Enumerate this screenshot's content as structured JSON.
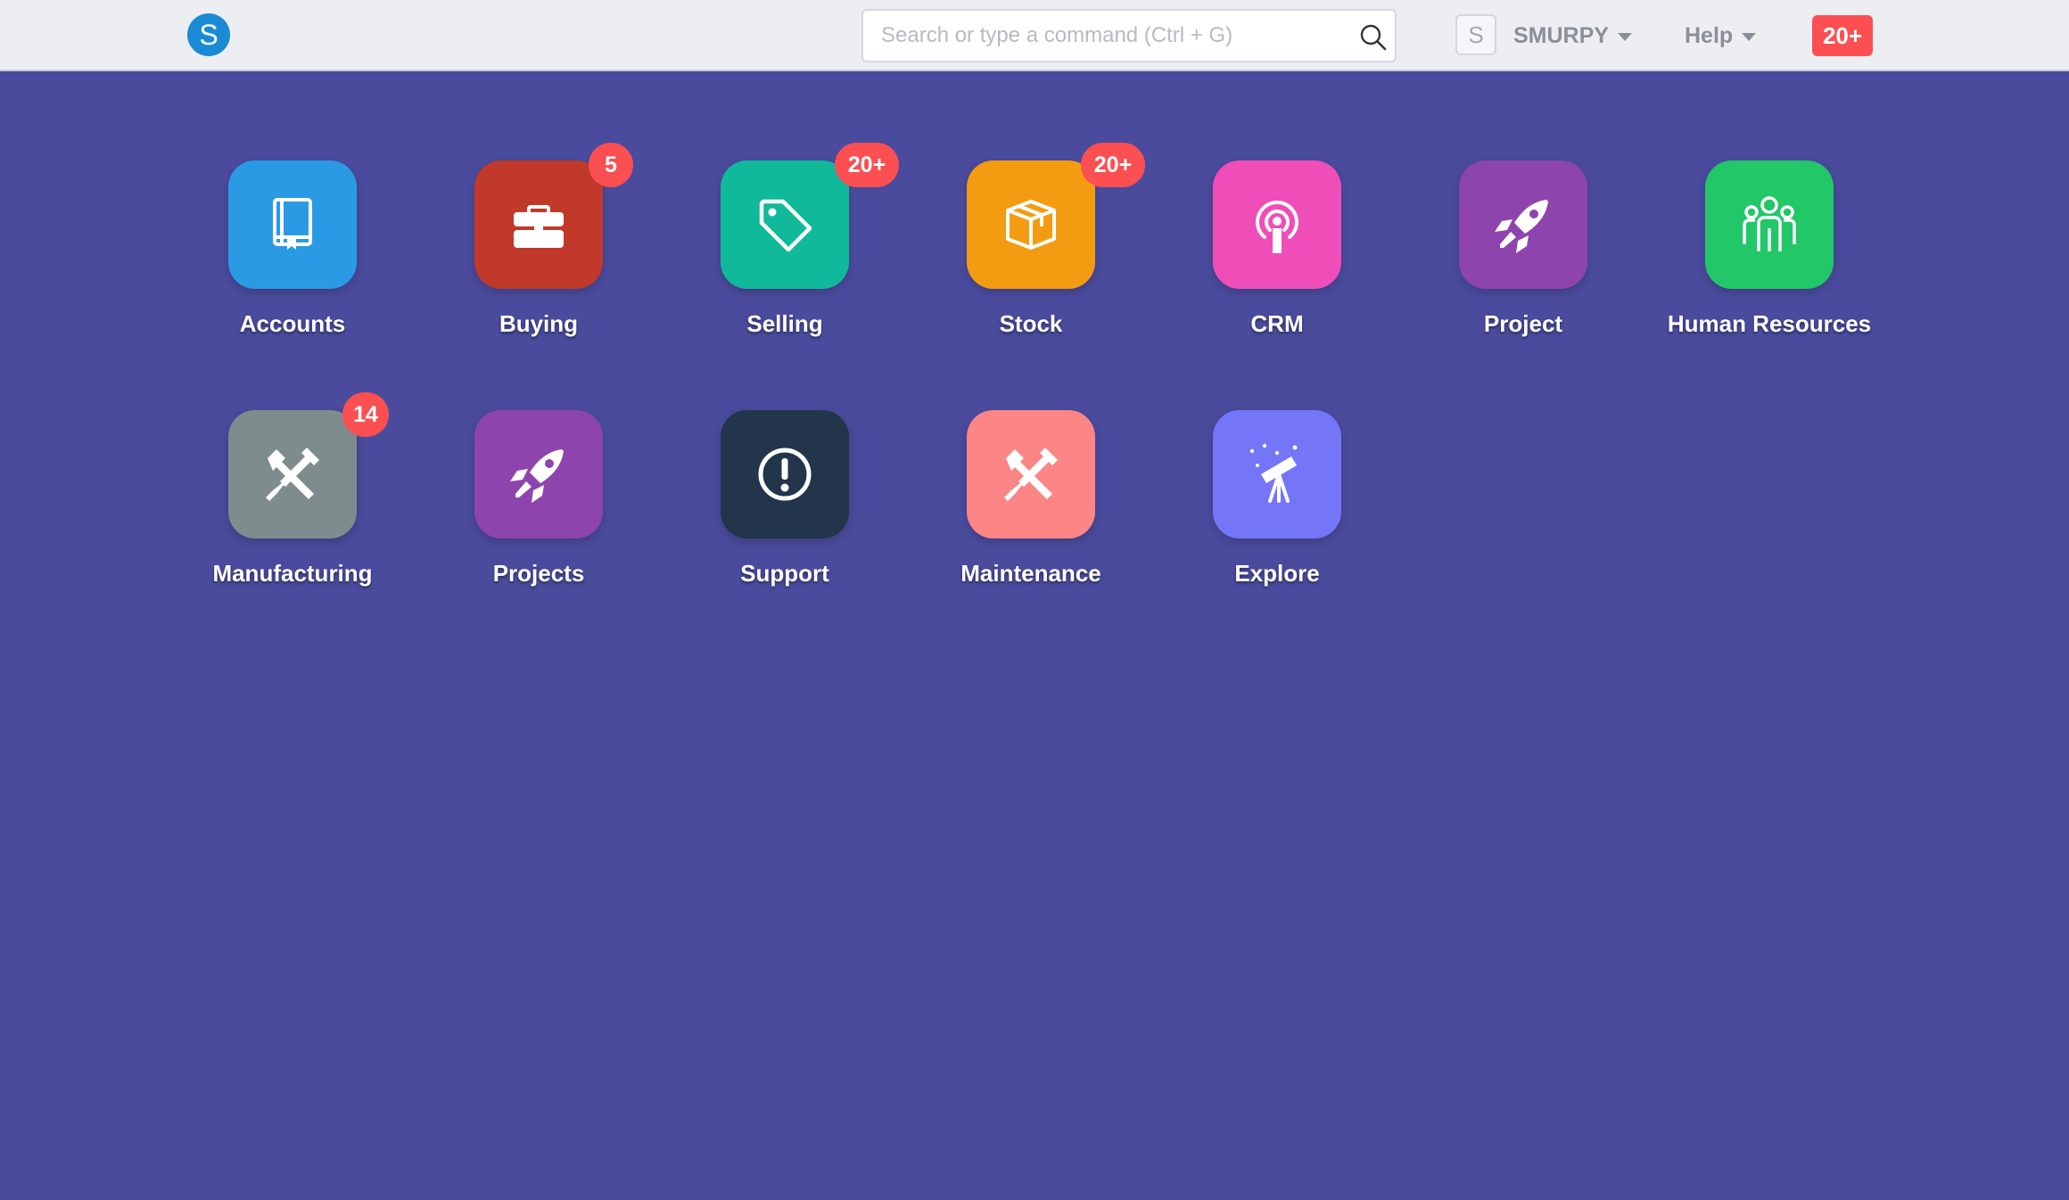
{
  "navbar": {
    "logo_letter": "S",
    "search_placeholder": "Search or type a command (Ctrl + G)",
    "avatar_letter": "S",
    "user_label": "SMURPY",
    "help_label": "Help",
    "notifications": "20+"
  },
  "modules": [
    {
      "label": "Accounts",
      "color": "#2b9ae4",
      "icon": "book-icon",
      "badge": ""
    },
    {
      "label": "Buying",
      "color": "#c0392b",
      "icon": "briefcase-icon",
      "badge": "5"
    },
    {
      "label": "Selling",
      "color": "#10b99a",
      "icon": "tag-icon",
      "badge": "20+"
    },
    {
      "label": "Stock",
      "color": "#f39c12",
      "icon": "box-icon",
      "badge": "20+"
    },
    {
      "label": "CRM",
      "color": "#ef4db7",
      "icon": "broadcast-icon",
      "badge": ""
    },
    {
      "label": "Project",
      "color": "#8e44ad",
      "icon": "rocket-icon",
      "badge": ""
    },
    {
      "label": "Human Resources",
      "color": "#22c768",
      "icon": "people-icon",
      "badge": ""
    },
    {
      "label": "Manufacturing",
      "color": "#7f8c8d",
      "icon": "tools-icon",
      "badge": "14"
    },
    {
      "label": "Projects",
      "color": "#8e44ad",
      "icon": "rocket-icon",
      "badge": ""
    },
    {
      "label": "Support",
      "color": "#22354b",
      "icon": "alert-icon",
      "badge": ""
    },
    {
      "label": "Maintenance",
      "color": "#fc8585",
      "icon": "tools-icon",
      "badge": ""
    },
    {
      "label": "Explore",
      "color": "#7575f8",
      "icon": "telescope-icon",
      "badge": ""
    }
  ]
}
